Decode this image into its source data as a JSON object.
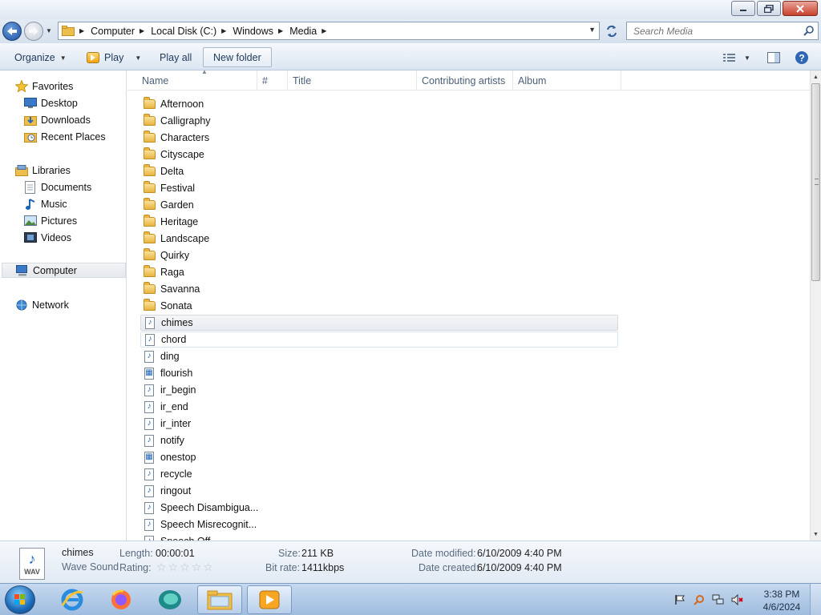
{
  "window": {
    "buttons": [
      "minimize",
      "restore",
      "close"
    ]
  },
  "address": {
    "breadcrumb": [
      "Computer",
      "Local Disk (C:)",
      "Windows",
      "Media"
    ],
    "search_placeholder": "Search Media"
  },
  "toolbar": {
    "organize_label": "Organize",
    "play_label": "Play",
    "play_all_label": "Play all",
    "new_folder_label": "New folder"
  },
  "nav": {
    "favorites": "Favorites",
    "desktop": "Desktop",
    "downloads": "Downloads",
    "recent_places": "Recent Places",
    "libraries": "Libraries",
    "documents": "Documents",
    "music": "Music",
    "pictures": "Pictures",
    "videos": "Videos",
    "computer": "Computer",
    "network": "Network"
  },
  "columns": {
    "name": "Name",
    "number": "#",
    "title": "Title",
    "contributing_artists": "Contributing artists",
    "album": "Album"
  },
  "files": [
    {
      "name": "Afternoon",
      "type": "folder"
    },
    {
      "name": "Calligraphy",
      "type": "folder"
    },
    {
      "name": "Characters",
      "type": "folder"
    },
    {
      "name": "Cityscape",
      "type": "folder"
    },
    {
      "name": "Delta",
      "type": "folder"
    },
    {
      "name": "Festival",
      "type": "folder"
    },
    {
      "name": "Garden",
      "type": "folder"
    },
    {
      "name": "Heritage",
      "type": "folder"
    },
    {
      "name": "Landscape",
      "type": "folder"
    },
    {
      "name": "Quirky",
      "type": "folder"
    },
    {
      "name": "Raga",
      "type": "folder"
    },
    {
      "name": "Savanna",
      "type": "folder"
    },
    {
      "name": "Sonata",
      "type": "folder"
    },
    {
      "name": "chimes",
      "type": "sound",
      "state": "selected"
    },
    {
      "name": "chord",
      "type": "sound",
      "state": "hover"
    },
    {
      "name": "ding",
      "type": "sound"
    },
    {
      "name": "flourish",
      "type": "midi"
    },
    {
      "name": "ir_begin",
      "type": "sound"
    },
    {
      "name": "ir_end",
      "type": "sound"
    },
    {
      "name": "ir_inter",
      "type": "sound"
    },
    {
      "name": "notify",
      "type": "sound"
    },
    {
      "name": "onestop",
      "type": "midi"
    },
    {
      "name": "recycle",
      "type": "sound"
    },
    {
      "name": "ringout",
      "type": "sound"
    },
    {
      "name": "Speech Disambigua...",
      "type": "sound"
    },
    {
      "name": "Speech Misrecognit...",
      "type": "sound"
    },
    {
      "name": "Speech Off",
      "type": "sound"
    }
  ],
  "details": {
    "file_name": "chimes",
    "file_type": "Wave Sound",
    "icon_label": "WAV",
    "length_label": "Length:",
    "length_value": "00:00:01",
    "rating_label": "Rating:",
    "rating_value": 0,
    "rating_max": 5,
    "size_label": "Size:",
    "size_value": "211 KB",
    "bitrate_label": "Bit rate:",
    "bitrate_value": "1411kbps",
    "modified_label": "Date modified:",
    "modified_value": "6/10/2009 4:40 PM",
    "created_label": "Date created:",
    "created_value": "6/10/2009 4:40 PM"
  },
  "taskbar": {
    "time": "3:38 PM",
    "date": "4/6/2024",
    "apps": [
      "internet-explorer-icon",
      "firefox-icon",
      "app-icon",
      "windows-explorer-icon",
      "media-player-icon"
    ]
  },
  "colors": {
    "accent": "#1d63b8",
    "folder": "#e9b43f",
    "header_text": "#4c607a"
  }
}
